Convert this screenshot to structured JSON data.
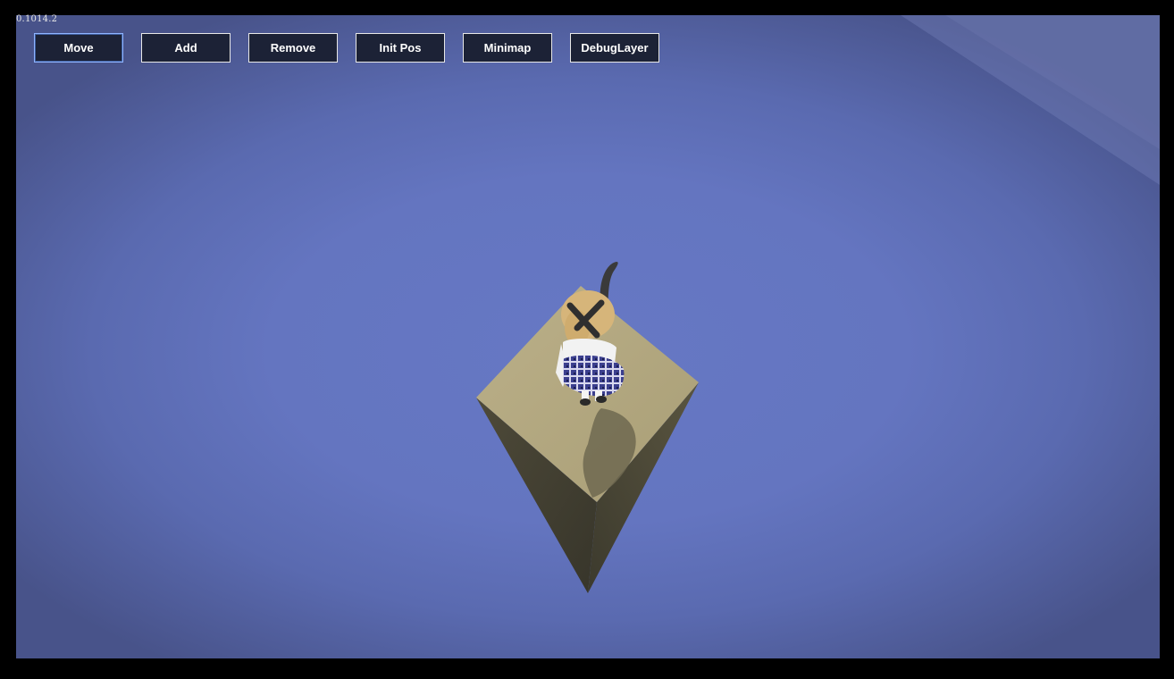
{
  "app": {
    "version": "0.1014.2"
  },
  "toolbar": {
    "buttons": [
      {
        "label": "Move",
        "active": true
      },
      {
        "label": "Add",
        "active": false
      },
      {
        "label": "Remove",
        "active": false
      },
      {
        "label": "Init Pos",
        "active": false
      },
      {
        "label": "Minimap",
        "active": false
      },
      {
        "label": "DebugLayer",
        "active": false
      }
    ]
  },
  "scene": {
    "background_color": "#6475c0",
    "platform_top_color": "#b2a77f",
    "platform_side_color": "#4a4636",
    "character": "girl-in-plaid-skirt-with-cat-ears"
  },
  "colors": {
    "button_bg": "#1c2236",
    "button_border": "#e8e8e8",
    "button_active_border": "#8fb4ff"
  }
}
